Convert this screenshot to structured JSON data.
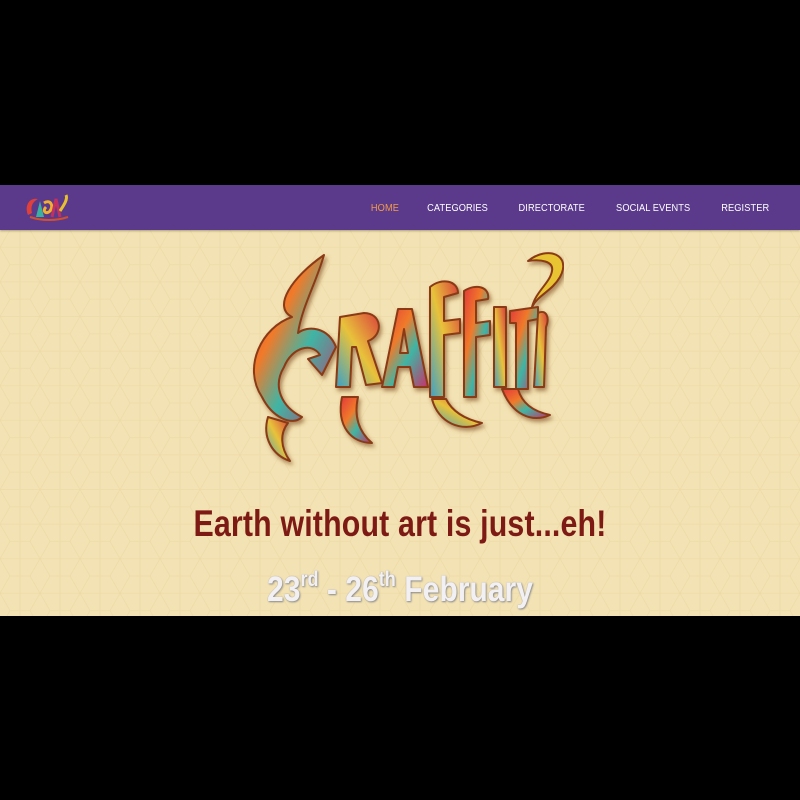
{
  "nav": {
    "logo_icon": "graffiti-logo-icon",
    "items": [
      {
        "label": "HOME",
        "active": true
      },
      {
        "label": "CATEGORIES",
        "active": false
      },
      {
        "label": "DIRECTORATE",
        "active": false
      },
      {
        "label": "SOCIAL EVENTS",
        "active": false
      },
      {
        "label": "REGISTER",
        "active": false
      }
    ]
  },
  "hero": {
    "logo_text": "Graffiti",
    "tagline": "Earth without art is just...eh!",
    "dates": {
      "start_day": "23",
      "start_suffix": "rd",
      "separator": " - ",
      "end_day": "26",
      "end_suffix": "th",
      "month": " February"
    }
  },
  "colors": {
    "navbar": "#5b3a8c",
    "active_nav": "#f29a4a",
    "background": "#f3e2b3",
    "tagline": "#7e1a14"
  }
}
